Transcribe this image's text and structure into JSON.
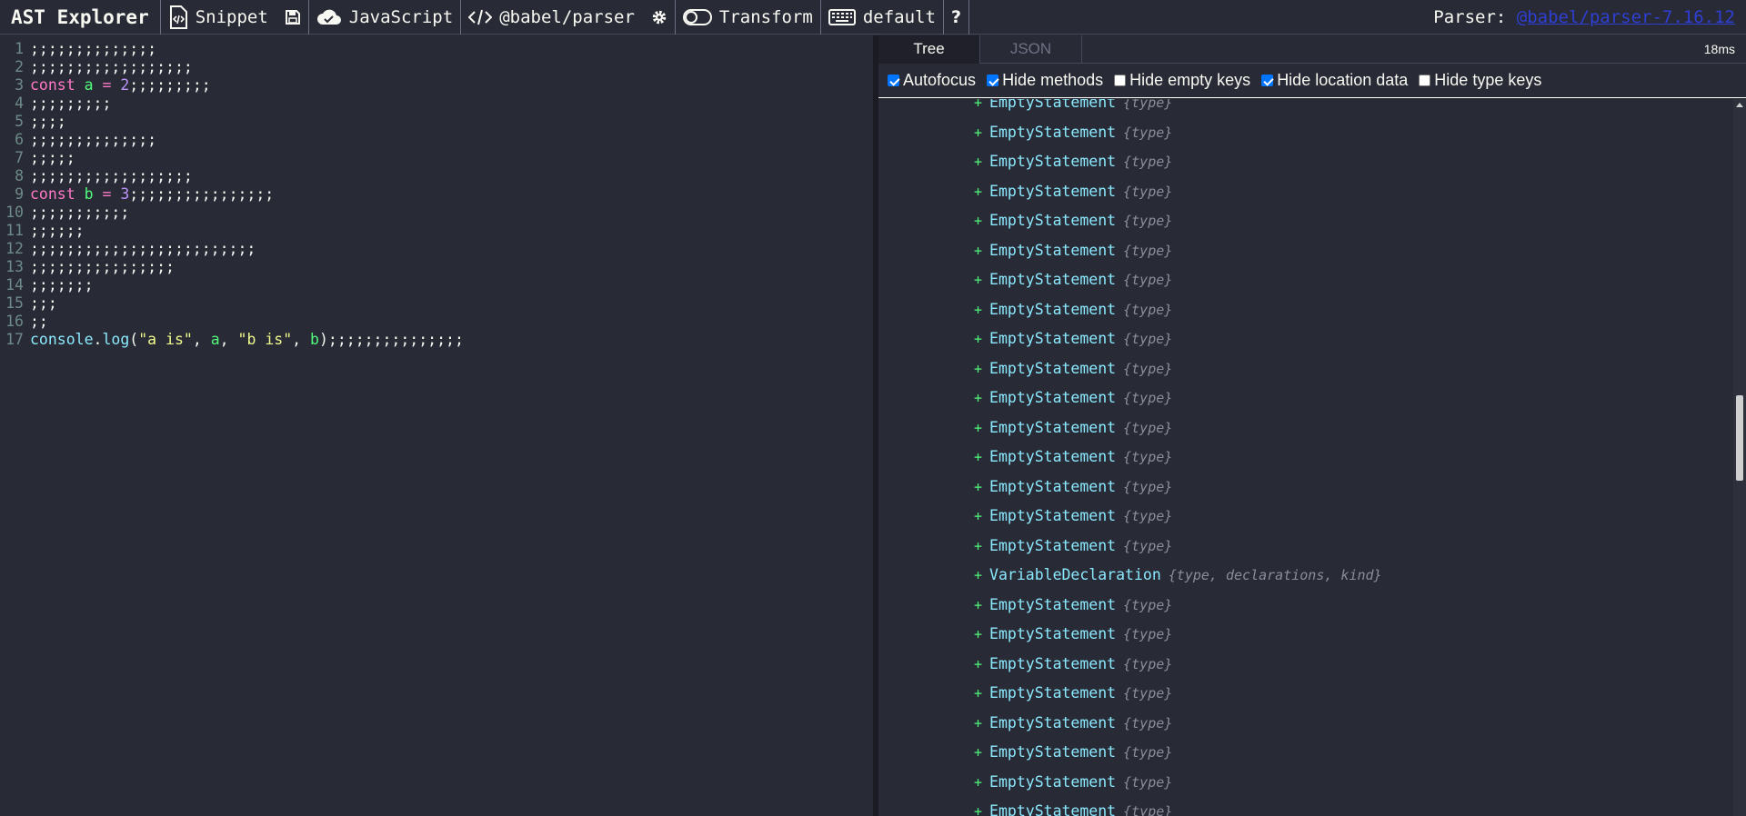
{
  "app": {
    "title": "AST Explorer"
  },
  "toolbar": {
    "snippet_label": "Snippet",
    "language_label": "JavaScript",
    "parser_label": "@babel/parser",
    "transform_label": "Transform",
    "keymap_label": "default",
    "help_label": "?",
    "parser_info_prefix": "Parser: ",
    "parser_version_link": "@babel/parser-7.16.12"
  },
  "editor": {
    "lines": [
      {
        "num": "1",
        "code": ";;;;;;;;;;;;;;"
      },
      {
        "num": "2",
        "code": ";;;;;;;;;;;;;;;;;;"
      },
      {
        "num": "3",
        "code": "const a = 2;;;;;;;;;"
      },
      {
        "num": "4",
        "code": ";;;;;;;;;"
      },
      {
        "num": "5",
        "code": ";;;;"
      },
      {
        "num": "6",
        "code": ";;;;;;;;;;;;;;"
      },
      {
        "num": "7",
        "code": ";;;;;"
      },
      {
        "num": "8",
        "code": ";;;;;;;;;;;;;;;;;;"
      },
      {
        "num": "9",
        "code": "const b = 3;;;;;;;;;;;;;;;;"
      },
      {
        "num": "10",
        "code": ";;;;;;;;;;;"
      },
      {
        "num": "11",
        "code": ";;;;;;"
      },
      {
        "num": "12",
        "code": ";;;;;;;;;;;;;;;;;;;;;;;;;"
      },
      {
        "num": "13",
        "code": ";;;;;;;;;;;;;;;;"
      },
      {
        "num": "14",
        "code": ";;;;;;;"
      },
      {
        "num": "15",
        "code": ";;;"
      },
      {
        "num": "16",
        "code": ";;"
      },
      {
        "num": "17",
        "code": "console.log(\"a is\", a, \"b is\", b);;;;;;;;;;;;;;;"
      }
    ]
  },
  "output": {
    "tabs": [
      {
        "label": "Tree",
        "active": true
      },
      {
        "label": "JSON",
        "active": false
      }
    ],
    "timing": "18ms",
    "options": [
      {
        "label": "Autofocus",
        "checked": true
      },
      {
        "label": "Hide methods",
        "checked": true
      },
      {
        "label": "Hide empty keys",
        "checked": false
      },
      {
        "label": "Hide location data",
        "checked": true
      },
      {
        "label": "Hide type keys",
        "checked": false
      }
    ],
    "tree_nodes": [
      {
        "name": "EmptyStatement",
        "keys": "{type}"
      },
      {
        "name": "EmptyStatement",
        "keys": "{type}"
      },
      {
        "name": "EmptyStatement",
        "keys": "{type}"
      },
      {
        "name": "EmptyStatement",
        "keys": "{type}"
      },
      {
        "name": "EmptyStatement",
        "keys": "{type}"
      },
      {
        "name": "EmptyStatement",
        "keys": "{type}"
      },
      {
        "name": "EmptyStatement",
        "keys": "{type}"
      },
      {
        "name": "EmptyStatement",
        "keys": "{type}"
      },
      {
        "name": "EmptyStatement",
        "keys": "{type}"
      },
      {
        "name": "EmptyStatement",
        "keys": "{type}"
      },
      {
        "name": "EmptyStatement",
        "keys": "{type}"
      },
      {
        "name": "EmptyStatement",
        "keys": "{type}"
      },
      {
        "name": "EmptyStatement",
        "keys": "{type}"
      },
      {
        "name": "EmptyStatement",
        "keys": "{type}"
      },
      {
        "name": "EmptyStatement",
        "keys": "{type}"
      },
      {
        "name": "EmptyStatement",
        "keys": "{type}"
      },
      {
        "name": "VariableDeclaration",
        "keys": "{type, declarations, kind}"
      },
      {
        "name": "EmptyStatement",
        "keys": "{type}"
      },
      {
        "name": "EmptyStatement",
        "keys": "{type}"
      },
      {
        "name": "EmptyStatement",
        "keys": "{type}"
      },
      {
        "name": "EmptyStatement",
        "keys": "{type}"
      },
      {
        "name": "EmptyStatement",
        "keys": "{type}"
      },
      {
        "name": "EmptyStatement",
        "keys": "{type}"
      },
      {
        "name": "EmptyStatement",
        "keys": "{type}"
      },
      {
        "name": "EmptyStatement",
        "keys": "{type}"
      }
    ]
  }
}
